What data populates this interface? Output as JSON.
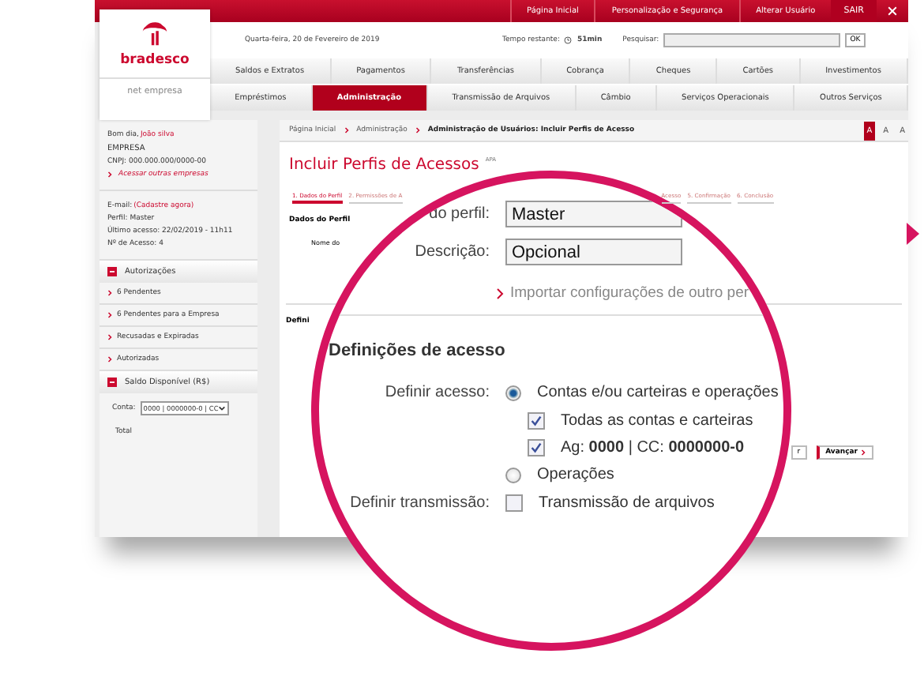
{
  "top_links": [
    "Página Inicial",
    "Personalização e Segurança",
    "Alterar Usuário"
  ],
  "exit_button": "SAIR",
  "logo": {
    "brand": "bradesco",
    "product": "net empresa"
  },
  "date": "Quarta-feira, 20 de Fevereiro de 2019",
  "time_left": {
    "label": "Tempo restante:",
    "value": "51min"
  },
  "search": {
    "label": "Pesquisar:",
    "button": "OK"
  },
  "nav_rows": [
    [
      {
        "label": "Saldos e Extratos",
        "selected": false
      },
      {
        "label": "Pagamentos",
        "selected": false
      },
      {
        "label": "Transferências",
        "selected": false
      },
      {
        "label": "Cobrança",
        "selected": false
      },
      {
        "label": "Cheques",
        "selected": false
      },
      {
        "label": "Cartões",
        "selected": false
      },
      {
        "label": "Investimentos",
        "selected": false
      }
    ],
    [
      {
        "label": "Empréstimos",
        "selected": false
      },
      {
        "label": "Administração",
        "selected": true
      },
      {
        "label": "Transmissão de Arquivos",
        "selected": false
      },
      {
        "label": "Câmbio",
        "selected": false
      },
      {
        "label": "Serviços Operacionais",
        "selected": false
      },
      {
        "label": "Outros Serviços",
        "selected": false
      }
    ]
  ],
  "sidebar": {
    "greeting": "Bom dia,",
    "user": "João silva",
    "company": "EMPRESA",
    "cnpj": "CNPJ: 000.000.000/0000-00",
    "switch_link": "Acessar outras empresas",
    "email_label": "E-mail:",
    "email_link": "(Cadastre agora)",
    "info": [
      "Perfil: Master",
      "Último acesso: 22/02/2019 - 11h11",
      "Nº de Acesso: 4"
    ],
    "sections": [
      {
        "title": "Autorizações",
        "expanded": true,
        "links": [
          "6 Pendentes",
          "6 Pendentes para a Empresa",
          "Recusadas e Expiradas",
          "Autorizadas"
        ]
      },
      {
        "title": "Saldo Disponível (R$)",
        "expanded": true
      }
    ],
    "account": {
      "label": "Conta:",
      "value": "0000 | 0000000-0 | CC"
    },
    "total": "Total"
  },
  "main": {
    "breadcrumb": [
      "Página Inicial",
      "Administração",
      "Administração de Usuários: Incluir Perfis de Acesso"
    ],
    "font_sizes": [
      {
        "label": "A",
        "selected": true
      },
      {
        "label": "A",
        "selected": false
      },
      {
        "label": "A",
        "selected": false
      }
    ],
    "title": "Incluir Perfis de Acessos",
    "title_tag": "APA",
    "steps": [
      {
        "label": "1. Dados do Perfil",
        "selected": true
      },
      {
        "label": "2. Permissões de A",
        "selected": false
      },
      {
        "label": "Acesso",
        "selected": false
      },
      {
        "label": "5. Confirmação",
        "selected": false
      },
      {
        "label": "6. Conclusão",
        "selected": false
      }
    ],
    "section": "Dados do Perfil",
    "field_label": "Nome do",
    "section_2": "Defini",
    "buttons": [
      {
        "label": "r",
        "kind": "secondary"
      },
      {
        "label": "Avançar",
        "kind": "primary"
      }
    ]
  },
  "magnifier": {
    "profile_label": "do perfil:",
    "profile_value": "Master",
    "desc_label": "Descrição:",
    "desc_value": "Opcional",
    "import_link": "Importar configurações de outro per",
    "heading": "Definições de acesso",
    "access_label": "Definir acesso:",
    "access_options": [
      {
        "label": "Contas e/ou carteiras e operações",
        "selected": true,
        "sub": [
          {
            "label": "Todas as contas e carteiras",
            "checked": true
          },
          {
            "label": "Ag: **0000** | CC: **0000000-0**",
            "checked": true
          }
        ]
      },
      {
        "label": "Operações",
        "selected": false
      }
    ],
    "transmission_label": "Definir transmissão:",
    "transmission": {
      "label": "Transmissão de arquivos",
      "checked": false
    }
  }
}
